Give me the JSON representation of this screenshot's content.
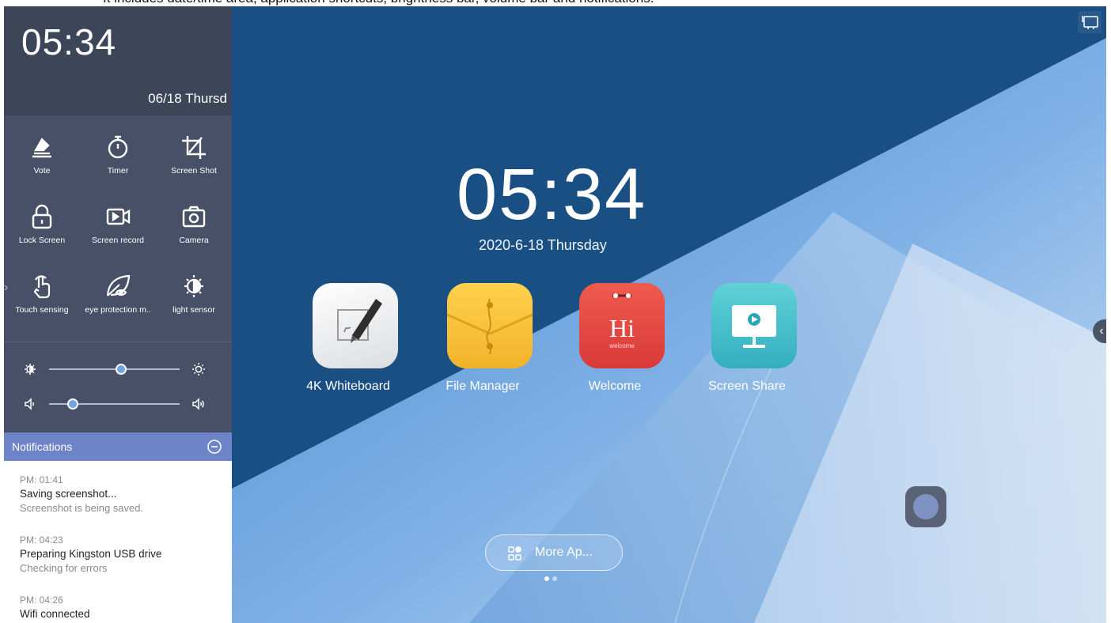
{
  "caption": "It includes date/time area, application shortcuts, brightness bar, volume bar and notifications.",
  "sidebar": {
    "time": "05:34",
    "date": "06/18  Thursd",
    "shortcuts": [
      {
        "label": "Vote",
        "icon": "vote-icon"
      },
      {
        "label": "Timer",
        "icon": "stopwatch-icon"
      },
      {
        "label": "Screen Shot",
        "icon": "crop-icon"
      },
      {
        "label": "Lock Screen",
        "icon": "lock-icon"
      },
      {
        "label": "Screen record",
        "icon": "video-record-icon"
      },
      {
        "label": "Camera",
        "icon": "camera-icon"
      },
      {
        "label": "Touch sensing",
        "icon": "touch-hand-icon"
      },
      {
        "label": "eye protection m..",
        "icon": "leaf-eye-icon"
      },
      {
        "label": "light sensor",
        "icon": "light-sensor-icon"
      }
    ],
    "brightness_level": 0.55,
    "volume_level": 0.18,
    "notifications": {
      "header": "Notifications",
      "items": [
        {
          "time": "PM: 01:41",
          "title": "Saving screenshot...",
          "detail": "Screenshot is being saved."
        },
        {
          "time": "PM: 04:23",
          "title": "Preparing Kingston USB drive",
          "detail": "Checking for errors"
        },
        {
          "time": "PM: 04:26",
          "title": "Wifi connected",
          "detail": ""
        }
      ]
    }
  },
  "desktop": {
    "time": "05:34",
    "date": "2020-6-18   Thursday",
    "apps": [
      {
        "name": "4K Whiteboard",
        "icon": "whiteboard-pen-icon"
      },
      {
        "name": "File Manager",
        "icon": "folder-envelope-icon"
      },
      {
        "name": "Welcome",
        "icon": "welcome-hi-icon",
        "tile_text": "Hi",
        "tile_subtext": "welcome"
      },
      {
        "name": "Screen Share",
        "icon": "screen-share-icon"
      }
    ],
    "more_apps_label": "More Ap...",
    "page_count": 2,
    "current_page": 1
  },
  "colors": {
    "sidebar_bg": "#475066",
    "clock_bg": "#3d4558",
    "notif_header": "#6e84c9",
    "slider_accent": "#6fa4e6",
    "desktop_dark": "#1a4f84",
    "desktop_light": "#cfe0f5"
  }
}
